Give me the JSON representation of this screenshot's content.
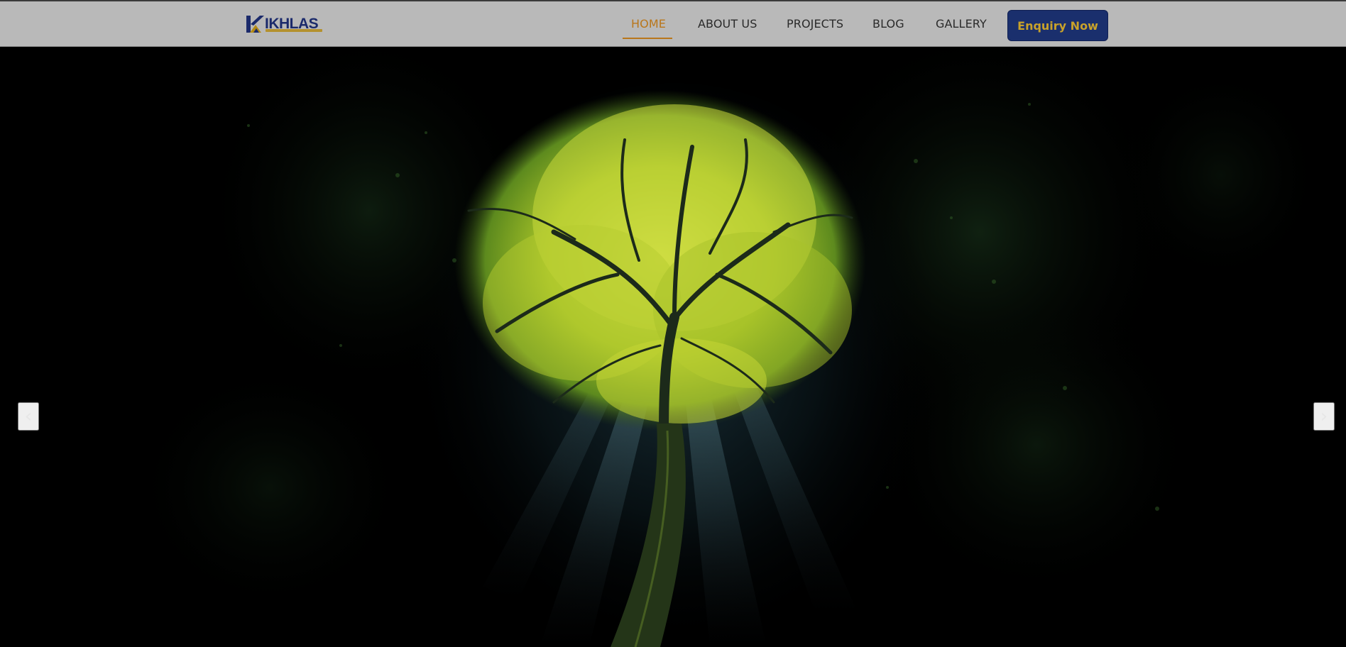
{
  "brand": {
    "name": "IKHLAS",
    "colors": {
      "navy": "#1b2a6b",
      "gold": "#b38a15"
    }
  },
  "nav": {
    "items": [
      {
        "label": "HOME",
        "active": true
      },
      {
        "label": "ABOUT US",
        "active": false
      },
      {
        "label": "PROJECTS",
        "active": false
      },
      {
        "label": "BLOG",
        "active": false
      },
      {
        "label": "GALLERY",
        "active": false
      }
    ],
    "cta_label": "Enquiry Now",
    "active_color": "#b9761a"
  },
  "hero": {
    "image": "glowing-tree-canopy",
    "prev_icon": "chevron-left-icon",
    "next_icon": "chevron-right-icon",
    "prev_glyph": "‹",
    "next_glyph": "›"
  }
}
